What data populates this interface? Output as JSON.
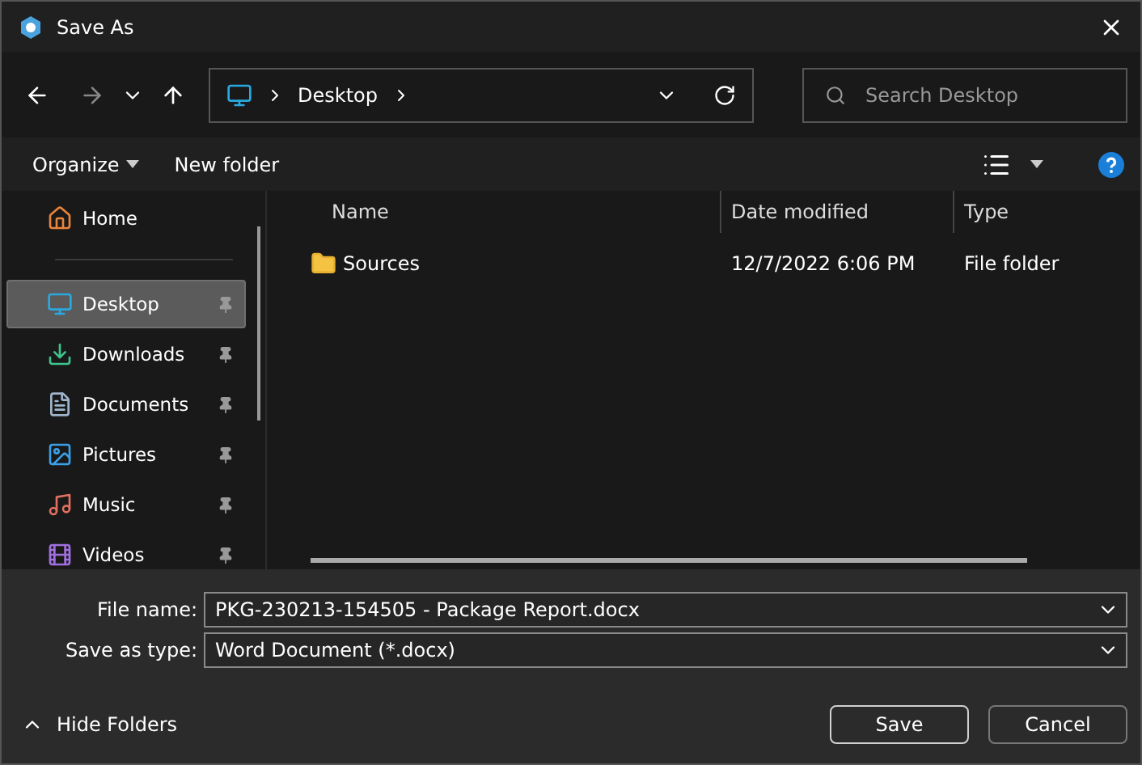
{
  "window": {
    "title": "Save As"
  },
  "address": {
    "segments": [
      "Desktop"
    ]
  },
  "search": {
    "placeholder": "Search Desktop"
  },
  "toolbar": {
    "buttons": [
      "Organize",
      "New folder"
    ]
  },
  "sidebar": {
    "items": [
      {
        "label": "Home",
        "kind": "home",
        "selected": false,
        "pinned": false
      },
      {
        "label": "Desktop",
        "kind": "desktop",
        "selected": true,
        "pinned": true
      },
      {
        "label": "Downloads",
        "kind": "downloads",
        "selected": false,
        "pinned": true
      },
      {
        "label": "Documents",
        "kind": "documents",
        "selected": false,
        "pinned": true
      },
      {
        "label": "Pictures",
        "kind": "pictures",
        "selected": false,
        "pinned": true
      },
      {
        "label": "Music",
        "kind": "music",
        "selected": false,
        "pinned": true
      },
      {
        "label": "Videos",
        "kind": "videos",
        "selected": false,
        "pinned": true
      }
    ]
  },
  "table": {
    "columns": [
      "Name",
      "Date modified",
      "Type"
    ],
    "rows": [
      {
        "name": "Sources",
        "date_modified": "12/7/2022 6:06 PM",
        "type": "File folder"
      }
    ]
  },
  "form": {
    "file_name_label": "File name:",
    "file_name": "PKG-230213-154505 - Package Report.docx",
    "type_label": "Save as type:",
    "type": "Word Document  (*.docx)"
  },
  "hide_folders": "Hide Folders",
  "buttons": [
    "Save",
    "Cancel"
  ]
}
